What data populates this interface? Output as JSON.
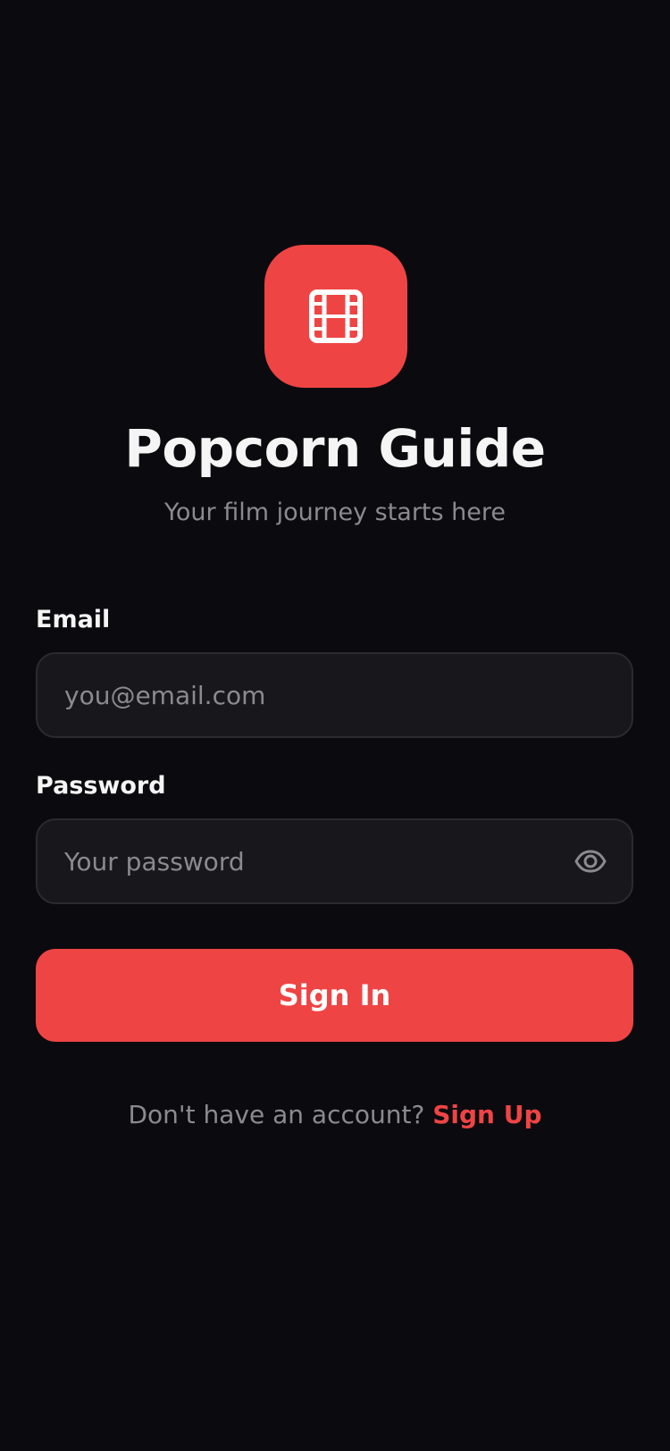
{
  "app": {
    "title": "Popcorn Guide",
    "subtitle": "Your film journey starts here",
    "logo_icon": "film-icon",
    "accent_color": "#ef4444",
    "background_color": "#0b0b0f"
  },
  "form": {
    "email": {
      "label": "Email",
      "value": "",
      "placeholder": "you@email.com"
    },
    "password": {
      "label": "Password",
      "value": "",
      "placeholder": "Your password",
      "toggle_icon": "eye-icon"
    },
    "submit_label": "Sign In"
  },
  "footer": {
    "prompt": "Don't have an account?",
    "link_label": "Sign Up"
  }
}
